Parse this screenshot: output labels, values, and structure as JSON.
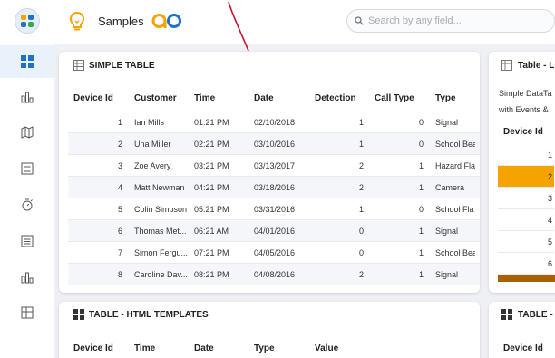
{
  "app": {
    "title": "Samples"
  },
  "search": {
    "placeholder": "Search by any field..."
  },
  "sidebar": {
    "items": [
      {
        "icon": "dashboard-grid-icon",
        "active": true
      },
      {
        "icon": "bar-chart-icon"
      },
      {
        "icon": "map-icon"
      },
      {
        "icon": "list-icon"
      },
      {
        "icon": "timer-icon"
      },
      {
        "icon": "list-icon"
      },
      {
        "icon": "bar-chart-icon"
      },
      {
        "icon": "table-layout-icon"
      }
    ]
  },
  "simple_table": {
    "title": "SIMPLE TABLE",
    "columns": [
      "Device Id",
      "Customer",
      "Time",
      "Date",
      "Detection",
      "Call Type",
      "Type"
    ],
    "rows": [
      [
        "1",
        "Ian Mills",
        "01:21 PM",
        "02/10/2018",
        "1",
        "0",
        "Signal"
      ],
      [
        "2",
        "Una Miller",
        "02:21 PM",
        "03/10/2016",
        "1",
        "0",
        "School Bea"
      ],
      [
        "3",
        "Zoe Avery",
        "03:21 PM",
        "03/13/2017",
        "2",
        "1",
        "Hazard Fla"
      ],
      [
        "4",
        "Matt Newman",
        "04:21 PM",
        "03/18/2016",
        "2",
        "1",
        "Camera"
      ],
      [
        "5",
        "Colin Simpson",
        "05:21 PM",
        "03/31/2016",
        "1",
        "0",
        "School Fla"
      ],
      [
        "6",
        "Thomas Met...",
        "06:21 AM",
        "04/01/2016",
        "0",
        "1",
        "Signal"
      ],
      [
        "7",
        "Simon Fergu...",
        "07:21 PM",
        "04/05/2016",
        "0",
        "1",
        "School Bea"
      ],
      [
        "8",
        "Caroline Dav...",
        "08:21 PM",
        "04/08/2016",
        "2",
        "1",
        "Signal"
      ]
    ]
  },
  "right_table": {
    "title": "Table - L",
    "subtitle_line1": "Simple DataTa",
    "subtitle_line2": "with Events &",
    "column": "Device Id",
    "rows": [
      "1",
      "2",
      "3",
      "4",
      "5",
      "6"
    ],
    "highlight_row": "2",
    "highlight_color": "#f5a300"
  },
  "html_templates_table": {
    "title": "TABLE - HTML TEMPLATES",
    "columns": [
      "Device Id",
      "Time",
      "Date",
      "Type",
      "Value"
    ]
  },
  "right_bottom": {
    "title": "TABLE -",
    "column": "Device Id"
  },
  "colors": {
    "accent": "#1e73c9",
    "brand_orange": "#f5a300",
    "highlight": "#f5a300"
  }
}
